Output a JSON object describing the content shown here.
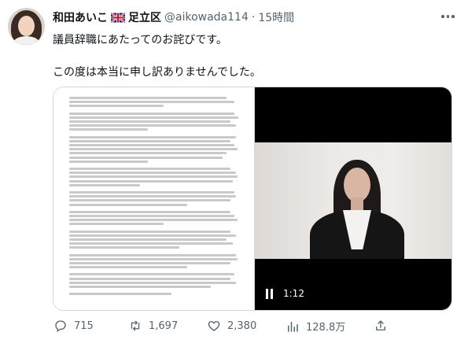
{
  "author": {
    "display_name": "和田あいこ",
    "flag": "uk-flag-icon",
    "region": "足立区",
    "handle": "@aikowada114",
    "separator": "·",
    "time": "15時間"
  },
  "tweet": {
    "line1": "議員辞職にあたってのお詫びです。",
    "line2": "この度は本当に申し訳ありませんでした。"
  },
  "media": {
    "video_time": "1:12",
    "video_state": "pause-icon"
  },
  "actions": {
    "reply_count": "715",
    "retweet_count": "1,697",
    "like_count": "2,380",
    "view_count": "128.8万",
    "share_icon": "share-icon"
  },
  "colors": {
    "text": "#0f1419",
    "muted": "#536471",
    "border": "#cfd9de"
  }
}
